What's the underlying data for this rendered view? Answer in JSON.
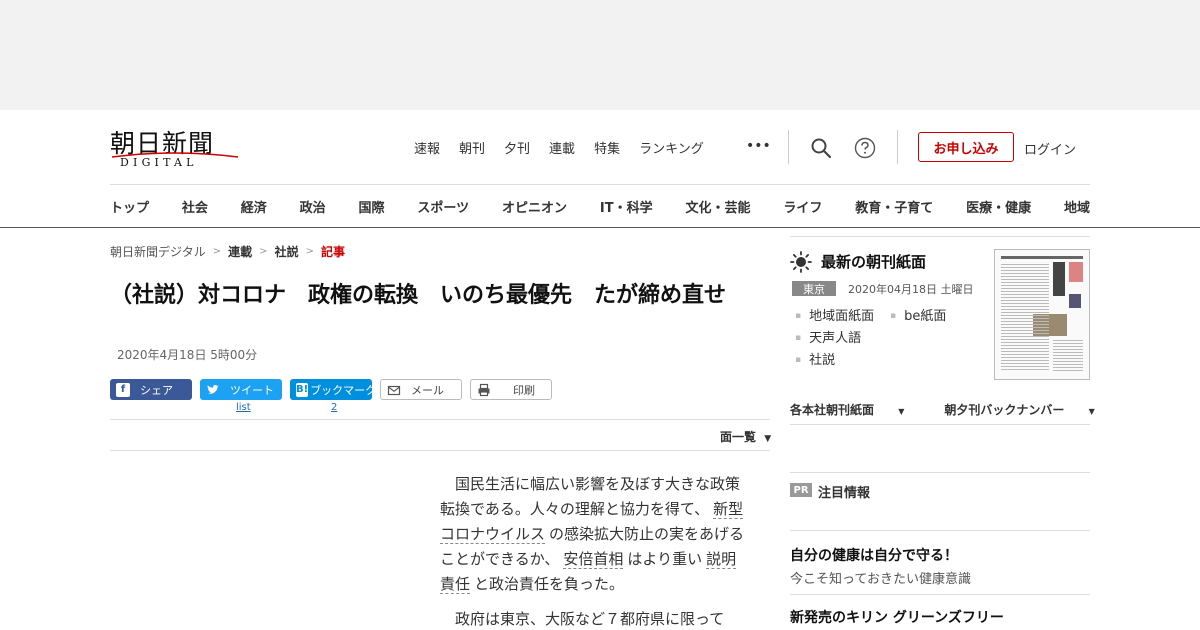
{
  "logo": {
    "main": "朝日新聞",
    "sub": "DIGITAL"
  },
  "top_nav": [
    "速報",
    "朝刊",
    "夕刊",
    "連載",
    "特集",
    "ランキング"
  ],
  "more_label": "•••",
  "header": {
    "subscribe_label": "お申し込み",
    "login_label": "ログイン"
  },
  "categories": [
    "トップ",
    "社会",
    "経済",
    "政治",
    "国際",
    "スポーツ",
    "オピニオン",
    "IT・科学",
    "文化・芸能",
    "ライフ",
    "教育・子育て",
    "医療・健康",
    "地域"
  ],
  "breadcrumb": {
    "home": "朝日新聞デジタル",
    "sep": ">",
    "c1": "連載",
    "c2": "社説",
    "current": "記事"
  },
  "article": {
    "title": "（社説）対コロナ　政権の転換　いのち最優先　たが締め直せ",
    "date": "2020年4月18日 5時00分",
    "paragraph1": {
      "t1": "国民生活に幅広い影響を及ぼす大きな政策転換である。人々の理解と協力を得て、",
      "k1": "新型コロナウイルス",
      "t2": "の感染拡大防止の実をあげることができるか、",
      "k2": "安倍首相",
      "t3": "はより重い",
      "k3": "説明責任",
      "t4": "と政治責任を負った。"
    },
    "paragraph2": "政府は東京、大阪など７都府県に限って"
  },
  "share": {
    "facebook": "シェア",
    "twitter": "ツイート",
    "twitter_count": "list",
    "hatena": "ブックマーク",
    "hatena_count": "2",
    "mail": "メール",
    "print": "印刷"
  },
  "menu_list_label": "面一覧",
  "sidebar": {
    "title": "最新の朝刊紙面",
    "edition": "東京",
    "issue_date": "2020年04月18日 土曜日",
    "links": [
      "地域面紙面",
      "be紙面",
      "天声人語",
      "社説"
    ],
    "dropdown1": "各本社朝刊紙面",
    "dropdown2": "朝夕刊バックナンバー",
    "pr_badge": "PR",
    "pr_title": "注目情報",
    "pr1_headline": "自分の健康は自分で守る！",
    "pr1_sub": "今こそ知っておきたい健康意識",
    "pr2_headline": "新発売のキリン グリーンズフリー"
  },
  "colors": {
    "accent_red": "#cc0000",
    "facebook": "#3b5998",
    "twitter": "#1da1f2",
    "hatena": "#008fde"
  }
}
